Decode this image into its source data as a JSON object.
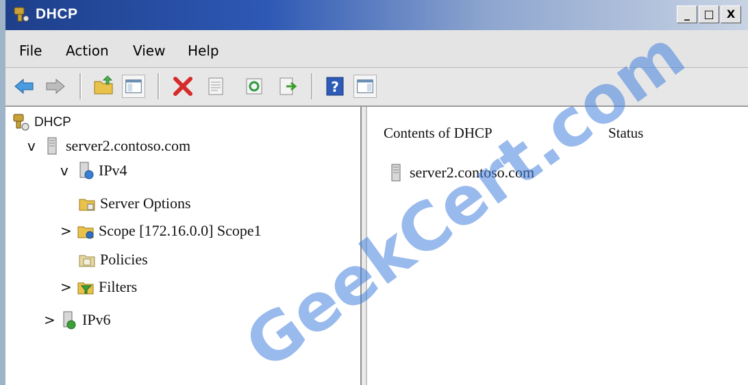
{
  "window": {
    "title": "DHCP",
    "controls": {
      "minimize": "_",
      "maximize": "□",
      "close": "X"
    }
  },
  "menu": [
    {
      "label": "File"
    },
    {
      "label": "Action"
    },
    {
      "label": "View"
    },
    {
      "label": "Help"
    }
  ],
  "toolbar": {
    "buttons": [
      "back-icon",
      "forward-icon",
      "up-folder-icon",
      "show-hide-console-tree-icon",
      "delete-icon",
      "properties-icon",
      "refresh-icon",
      "export-list-icon",
      "help-icon",
      "show-hide-action-pane-icon"
    ]
  },
  "tree": {
    "root": {
      "label": "DHCP"
    },
    "server": {
      "label": "server2.contoso.com",
      "expander": "v"
    },
    "ipv4": {
      "label": "IPv4",
      "expander": "v"
    },
    "server_options": {
      "label": "Server Options"
    },
    "scope": {
      "label": "Scope [172.16.0.0] Scope1",
      "expander": ">"
    },
    "policies": {
      "label": "Policies"
    },
    "filters": {
      "label": "Filters",
      "expander": ">"
    },
    "ipv6": {
      "label": "IPv6",
      "expander": ">"
    }
  },
  "details": {
    "columns": [
      "Contents of DHCP",
      "Status"
    ],
    "items": [
      {
        "name": "server2.contoso.com"
      }
    ]
  },
  "watermark": "GeekCert.com"
}
